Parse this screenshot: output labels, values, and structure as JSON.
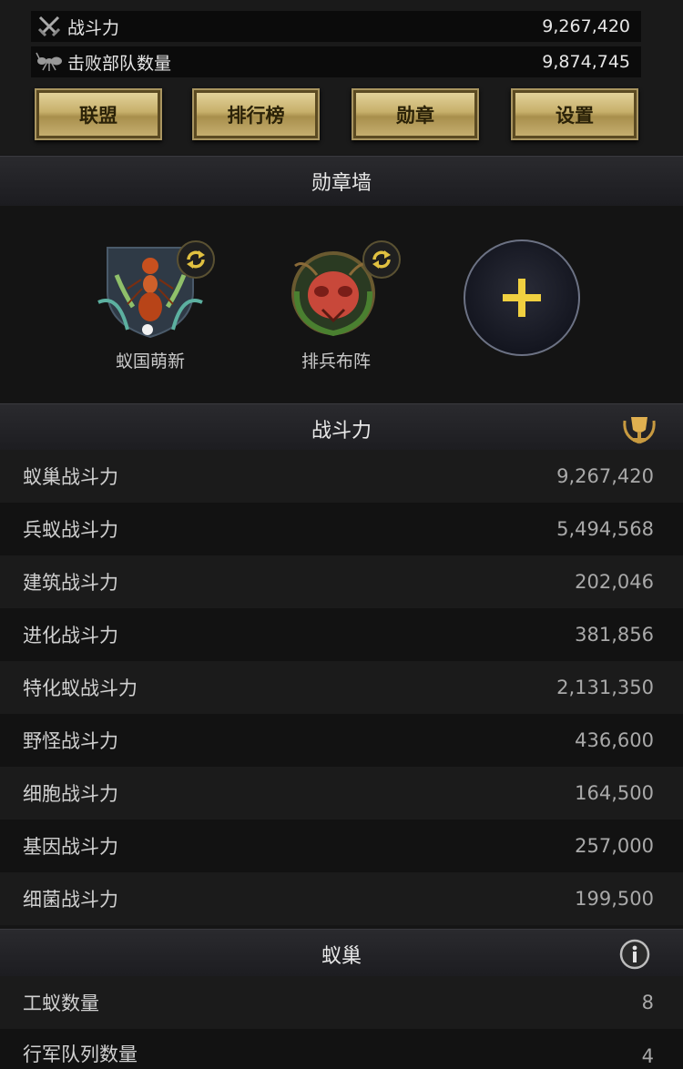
{
  "top_stats": [
    {
      "label": "战斗力",
      "value": "9,267,420",
      "icon": "crossed-swords-icon"
    },
    {
      "label": "击败部队数量",
      "value": "9,874,745",
      "icon": "ant-icon"
    }
  ],
  "nav_buttons": [
    {
      "label": "联盟"
    },
    {
      "label": "排行榜"
    },
    {
      "label": "勋章"
    },
    {
      "label": "设置"
    }
  ],
  "medal_wall": {
    "title": "勋章墙",
    "medals": [
      {
        "name": "蚁国萌新",
        "icon": "red-ant-shield-medal-icon"
      },
      {
        "name": "排兵布阵",
        "icon": "ant-head-wreath-medal-icon"
      }
    ],
    "add_icon": "plus-icon"
  },
  "combat": {
    "title": "战斗力",
    "icon": "trophy-icon",
    "rows": [
      {
        "label": "蚁巢战斗力",
        "value": "9,267,420"
      },
      {
        "label": "兵蚁战斗力",
        "value": "5,494,568"
      },
      {
        "label": "建筑战斗力",
        "value": "202,046"
      },
      {
        "label": "进化战斗力",
        "value": "381,856"
      },
      {
        "label": "特化蚁战斗力",
        "value": "2,131,350"
      },
      {
        "label": "野怪战斗力",
        "value": "436,600"
      },
      {
        "label": "细胞战斗力",
        "value": "164,500"
      },
      {
        "label": "基因战斗力",
        "value": "257,000"
      },
      {
        "label": "细菌战斗力",
        "value": "199,500"
      }
    ]
  },
  "nest": {
    "title": "蚁巢",
    "icon": "info-icon",
    "rows": [
      {
        "label": "工蚁数量",
        "value": "8"
      },
      {
        "label": "行军队列数量",
        "value": "4"
      }
    ]
  },
  "colors": {
    "gold": "#c7b06b",
    "background": "#151515"
  }
}
